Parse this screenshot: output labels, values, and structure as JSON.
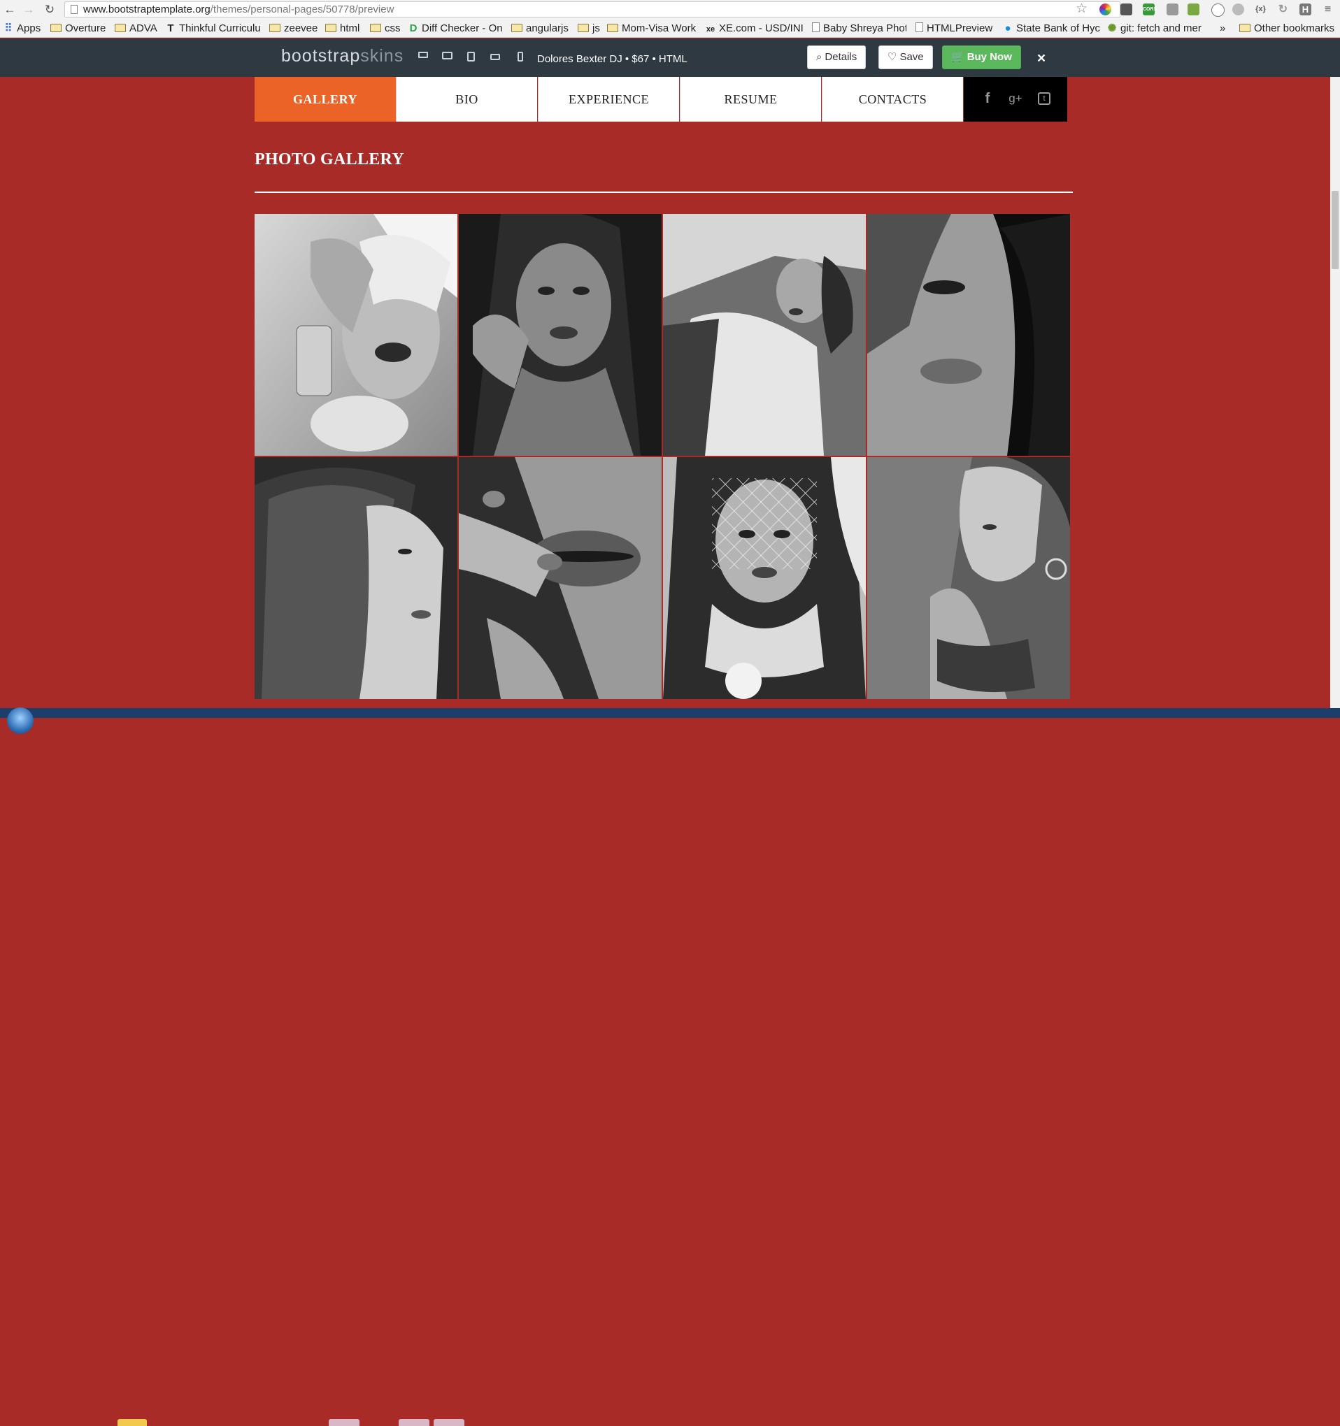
{
  "browser": {
    "url_host": "www.bootstraptemplate.org",
    "url_path": "/themes/personal-pages/50778/preview",
    "extensions": [
      "colorpicker-icon",
      "screenshot-icon",
      "cors-icon",
      "toolbar-icon",
      "sheets-icon",
      "clock-icon",
      "feather-icon",
      "json-icon",
      "reload-icon",
      "h-icon",
      "menu-icon"
    ],
    "extension_labels": [
      "",
      "",
      "CORS",
      "",
      "",
      "",
      "",
      "{x}",
      "",
      "H",
      ""
    ],
    "bookmarks": {
      "apps": "Apps",
      "items": [
        "Overture",
        "ADVA",
        "Thinkful Curriculu",
        "zeevee",
        "html",
        "css",
        "Diff Checker - On",
        "angularjs",
        "js",
        "Mom-Visa Work",
        "XE.com - USD/INI",
        "Baby Shreya Phot",
        "HTMLPreview",
        "State Bank of Hyc",
        "git: fetch and mer"
      ],
      "more": "»",
      "other": "Other bookmarks"
    }
  },
  "preview_bar": {
    "brand_bold": "bootstrap",
    "brand_light": "skins",
    "product_info": "Dolores Bexter DJ • $67 • HTML",
    "details_label": "Details",
    "save_label": "Save",
    "buy_label": "Buy Now",
    "close_label": "×",
    "colors": {
      "bar": "#2f3942",
      "buy": "#5cb85c"
    }
  },
  "site": {
    "nav": [
      "GALLERY",
      "BIO",
      "EXPERIENCE",
      "RESUME",
      "CONTACTS"
    ],
    "active_nav": "GALLERY",
    "social": {
      "facebook": "f",
      "google_plus": "g+",
      "twitter": "t"
    },
    "gallery_title": "PHOTO GALLERY",
    "colors": {
      "background": "#a82b27",
      "active": "#ec6328"
    },
    "photos": [
      {
        "subject": "woman-with-white-hair-and-bracelet"
      },
      {
        "subject": "woman-portrait-hand-on-head"
      },
      {
        "subject": "woman-lying-white-shirt"
      },
      {
        "subject": "woman-close-up-face"
      },
      {
        "subject": "woman-long-straight-hair-profile"
      },
      {
        "subject": "close-up-lips-with-glitter-nails"
      },
      {
        "subject": "woman-with-veil-and-necklace"
      },
      {
        "subject": "woman-profile-with-earrings"
      }
    ]
  }
}
